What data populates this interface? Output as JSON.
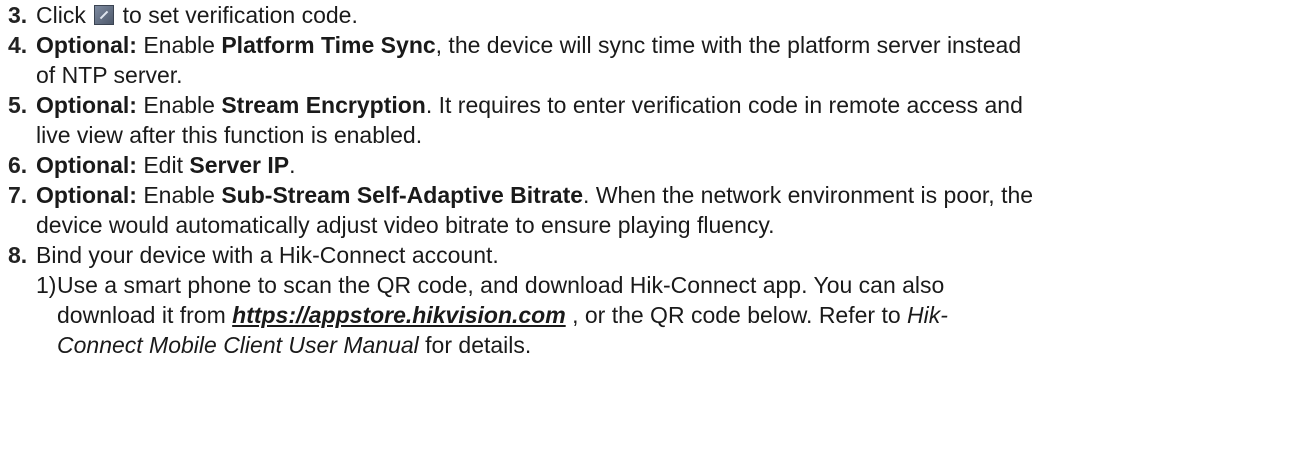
{
  "steps": [
    {
      "num": "3.",
      "lines": [
        {
          "parts": [
            "Click ",
            "@icon",
            " to set verification code."
          ]
        }
      ]
    },
    {
      "num": "4.",
      "lines": [
        {
          "parts": [
            "**Optional:",
            " Enable ",
            "**Platform Time Sync",
            ", the device will sync time with the platform server instead"
          ]
        },
        {
          "parts": [
            "of NTP server."
          ]
        }
      ]
    },
    {
      "num": "5.",
      "lines": [
        {
          "parts": [
            "**Optional:",
            " Enable ",
            "**Stream Encryption",
            ". It requires to enter verification code in remote access and"
          ]
        },
        {
          "parts": [
            "live view after this function is enabled."
          ]
        }
      ]
    },
    {
      "num": "6.",
      "lines": [
        {
          "parts": [
            "**Optional:",
            " Edit ",
            "**Server IP",
            "."
          ]
        }
      ]
    },
    {
      "num": "7.",
      "lines": [
        {
          "parts": [
            "**Optional:",
            " Enable ",
            "**Sub-Stream Self-Adaptive Bitrate",
            ". When the network environment is poor, the"
          ]
        },
        {
          "parts": [
            "device would automatically adjust video bitrate to ensure playing fluency."
          ]
        }
      ]
    },
    {
      "num": "8.",
      "lines": [
        {
          "parts": [
            "Bind your device with a Hik-Connect account."
          ]
        }
      ]
    }
  ],
  "substeps": [
    {
      "num": "1)",
      "lines": [
        {
          "parts": [
            "Use a smart phone to scan the QR code, and download Hik-Connect app. You can also"
          ]
        },
        {
          "parts": [
            "download it from ",
            "~~https://appstore.hikvision.com",
            " , or the QR code below. Refer to ",
            "__Hik-"
          ]
        },
        {
          "parts": [
            "__Connect Mobile Client User Manual",
            " for details."
          ]
        }
      ]
    }
  ],
  "icon": {
    "name": "edit-icon",
    "color": "#5a6578"
  }
}
